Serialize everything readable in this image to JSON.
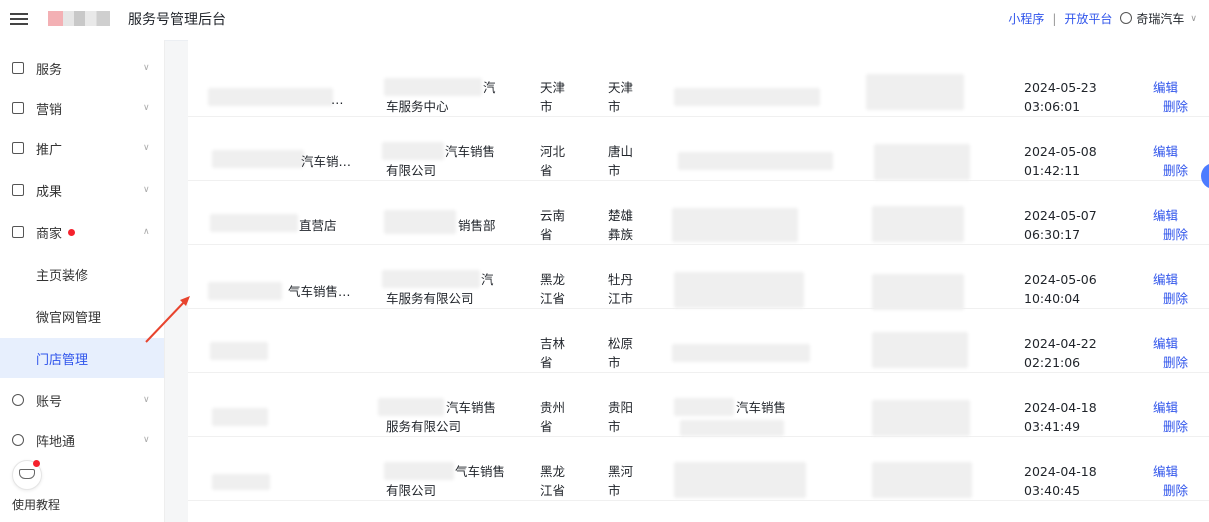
{
  "header": {
    "title": "服务号管理后台",
    "links": [
      "小程序",
      "开放平台"
    ],
    "separator": "|",
    "user": "奇瑞汽车",
    "caret": "∨"
  },
  "sidebar": {
    "items": [
      {
        "label": "服务",
        "arrow": "∨"
      },
      {
        "label": "营销",
        "arrow": "∨"
      },
      {
        "label": "推广",
        "arrow": "∨"
      },
      {
        "label": "成果",
        "arrow": "∨"
      },
      {
        "label": "商家",
        "arrow": "∧"
      },
      {
        "label": "账号",
        "arrow": "∨"
      },
      {
        "label": "阵地通",
        "arrow": "∨"
      }
    ],
    "sub_items": [
      "主页装修",
      "微官网管理",
      "门店管理"
    ],
    "tutorial": "使用教程"
  },
  "rows": [
    {
      "name": "…",
      "company": [
        "汽",
        "车服务中心"
      ],
      "province": [
        "天津",
        "市"
      ],
      "city": [
        "天津",
        "市"
      ],
      "date": "2024-05-23",
      "time": "03:06:01"
    },
    {
      "name": "汽车销…",
      "company": [
        "汽车销售",
        "有限公司"
      ],
      "province": [
        "河北",
        "省"
      ],
      "city": [
        "唐山",
        "市"
      ],
      "date": "2024-05-08",
      "time": "01:42:11"
    },
    {
      "name": "直营店",
      "company": [
        "销售部",
        ""
      ],
      "province": [
        "云南",
        "省"
      ],
      "city": [
        "楚雄",
        "彝族"
      ],
      "date": "2024-05-07",
      "time": "06:30:17"
    },
    {
      "name": "气车销售…",
      "company": [
        "汽",
        "车服务有限公司"
      ],
      "province": [
        "黑龙",
        "江省"
      ],
      "city": [
        "牡丹",
        "江市"
      ],
      "date": "2024-05-06",
      "time": "10:40:04"
    },
    {
      "name": "",
      "company": [
        "",
        ""
      ],
      "province": [
        "吉林",
        "省"
      ],
      "city": [
        "松原",
        "市"
      ],
      "date": "2024-04-22",
      "time": "02:21:06"
    },
    {
      "name": "",
      "company": [
        "汽车销售",
        "服务有限公司"
      ],
      "province": [
        "贵州",
        "省"
      ],
      "city": [
        "贵阳",
        "市"
      ],
      "address": "汽车销售",
      "date": "2024-04-18",
      "time": "03:41:49"
    },
    {
      "name": "",
      "company": [
        "气车销售",
        "有限公司"
      ],
      "province": [
        "黑龙",
        "江省"
      ],
      "city": [
        "黑河",
        "市"
      ],
      "date": "2024-04-18",
      "time": "03:40:45"
    }
  ],
  "actions": {
    "edit": "编辑",
    "delete": "删除"
  },
  "colors": {
    "accent": "#2f54eb",
    "active_bg": "#e7effd",
    "dot": "#f5222d",
    "arrow": "#e8442e"
  }
}
